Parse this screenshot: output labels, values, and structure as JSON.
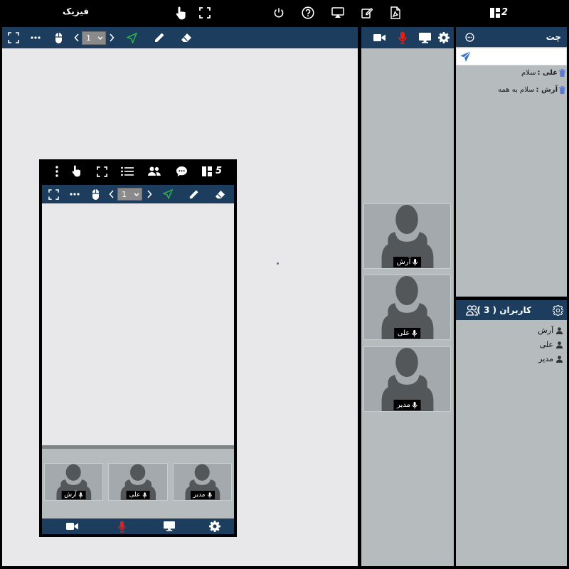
{
  "topbar": {
    "title": "فیزیک",
    "layout_count": "2"
  },
  "board": {
    "page_number": "1"
  },
  "video_tiles": [
    {
      "name": "آرش"
    },
    {
      "name": "علی"
    },
    {
      "name": "مدیر"
    }
  ],
  "chat": {
    "title": "چت",
    "input_placeholder": "",
    "messages": [
      {
        "sender": "علی :",
        "text": "سلام"
      },
      {
        "sender": "آرش :",
        "text": "سلام به همه"
      }
    ]
  },
  "users": {
    "title": "کاربران ( 3 )",
    "items": [
      {
        "name": "آرش"
      },
      {
        "name": "علی"
      },
      {
        "name": "مدیر"
      }
    ]
  },
  "mobile": {
    "layout_count": "5",
    "page_number": "1",
    "video_tiles": [
      {
        "name": "آرش"
      },
      {
        "name": "علی"
      },
      {
        "name": "مدیر"
      }
    ]
  },
  "colors": {
    "toolbar": "#1c3d5e",
    "panel_bg": "#b6bbbe",
    "board_bg": "#e8e7ea",
    "mic_active": "#e0201b",
    "laser_pointer": "#2bb34a",
    "link_blue": "#3a74c9"
  },
  "icons": [
    "hand-pointer-icon",
    "fullscreen-icon",
    "power-icon",
    "help-icon",
    "screen-share-icon",
    "edit-icon",
    "pdf-icon",
    "layout-icon",
    "more-icon",
    "mouse-icon",
    "chevron-left-icon",
    "chevron-right-icon",
    "laser-pointer-icon",
    "pencil-icon",
    "eraser-icon",
    "camera-icon",
    "microphone-icon",
    "monitor-icon",
    "gear-icon",
    "chat-icon",
    "send-icon",
    "trash-icon",
    "users-icon",
    "user-icon",
    "menu-dots-icon",
    "list-icon",
    "comment-icon"
  ]
}
